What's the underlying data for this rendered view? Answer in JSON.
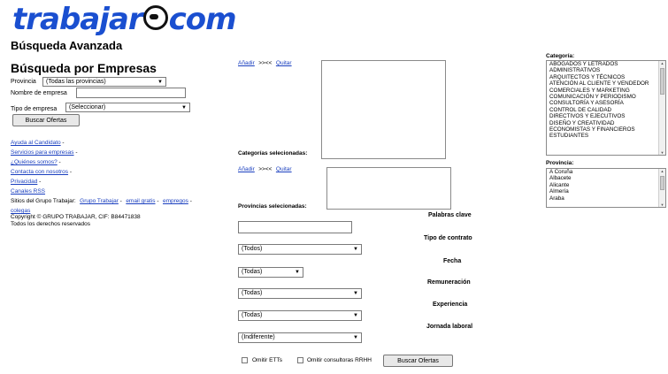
{
  "logo": {
    "pre": "trabajar",
    "post": "com"
  },
  "left": {
    "title": "Búsqueda Avanzada",
    "section_title": "Búsqueda por Empresas",
    "provincia_label": "Provincia",
    "provincia_value": "(Todas las provincias)",
    "nombre_label": "Nombre de empresa",
    "nombre_value": "",
    "tipo_label": "Tipo de empresa",
    "tipo_value": "(Seleccionar)",
    "search_button": "Buscar Ofertas",
    "links": {
      "ayuda": "Ayuda al Candidato",
      "servicios": "Servicios para empresas",
      "quienes": "¿Quiénes somos?",
      "contacta": "Contacta con nosotros",
      "privacidad": "Privacidad",
      "canales": "Canales RSS",
      "grupo_trabajar": "Grupo Trabajar",
      "email_gratis": "email gratis",
      "empregos": "empregos",
      "colegas": "colegas"
    },
    "sep": " -",
    "sitios_label": "Sitios del Grupo Trabajar:",
    "copyright": "Copyright © GRUPO TRABAJAR, CIF: B84471838",
    "rights": "Todos los derechos reservados"
  },
  "middle": {
    "add_link": "Añadir",
    "arrows": ">>",
    "arrows2": "<<",
    "remove_link": "Quitar",
    "cat_selected_label": "Categorías selecionadas:",
    "prov_selected_label": "Provincias selecionadas:",
    "keywords_label": "Palabras clave",
    "keywords_value": "",
    "contract_label": "Tipo de contrato",
    "contract_value": "(Todos)",
    "date_label": "Fecha",
    "date_value": "(Todas)",
    "pay_label": "Remuneración",
    "pay_value": "(Todas)",
    "exp_label": "Experiencia",
    "exp_value": "(Todas)",
    "schedule_label": "Jornada laboral",
    "schedule_value": "(Indiferente)",
    "omit_etts": "Omitir ETTs",
    "omit_consultoras": "Omitir consultoras RRHH",
    "search_button": "Buscar Ofertas"
  },
  "right": {
    "cat_label": "Categoría:",
    "categories": [
      "Abogados y letrados",
      "Administrativos",
      "Arquitectos y técnicos",
      "Atención al cliente y vendedor",
      "Comerciales y marketing",
      "Comunicación y periodismo",
      "Consultoría y asesoría",
      "Control de calidad",
      "Directivos y ejecutivos",
      "Diseño y creatividad",
      "Economistas y financieros",
      "Estudiantes"
    ],
    "prov_label": "Provincia:",
    "provinces": [
      "A Coruña",
      "Albacete",
      "Alicante",
      "Almería",
      "Araba"
    ]
  },
  "colors": {
    "link": "#1a3fbf",
    "logo": "#1a4fd0"
  }
}
